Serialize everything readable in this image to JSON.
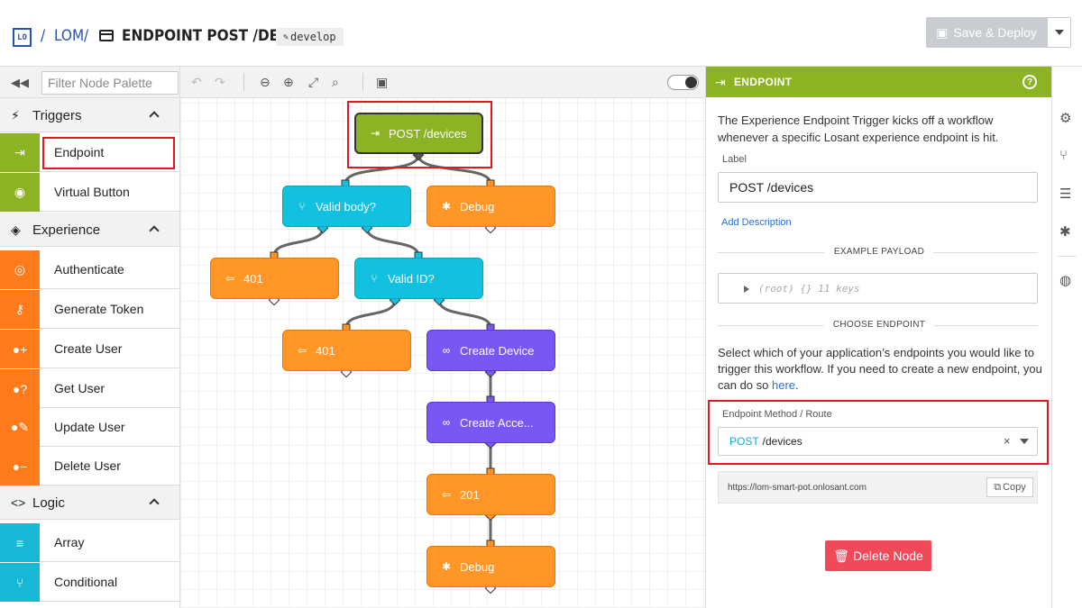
{
  "header": {
    "logo_text": "LO",
    "sep1": "/",
    "app_name": "LOM",
    "sep2": "/",
    "workflow_title": "ENDPOINT POST /DEVICES",
    "branch": "develop",
    "save_label": "Save & Deploy"
  },
  "palette": {
    "filter_placeholder": "Filter Node Palette",
    "categories": [
      {
        "label": "Triggers",
        "items": [
          "Endpoint",
          "Virtual Button"
        ]
      },
      {
        "label": "Experience",
        "items": [
          "Authenticate",
          "Generate Token",
          "Create User",
          "Get User",
          "Update User",
          "Delete User"
        ]
      },
      {
        "label": "Logic",
        "items": [
          "Array",
          "Conditional"
        ]
      }
    ]
  },
  "flow": {
    "nodes": {
      "trigger": "POST /devices",
      "valid_body": "Valid body?",
      "debug1": "Debug",
      "resp401a": "401",
      "valid_id": "Valid ID?",
      "resp401b": "401",
      "create_device": "Create Device",
      "create_access": "Create Acce...",
      "resp201": "201",
      "debug2": "Debug"
    }
  },
  "panel": {
    "title": "ENDPOINT",
    "description": "The Experience Endpoint Trigger kicks off a workflow whenever a specific Losant experience endpoint is hit.",
    "label_caption": "Label",
    "label_value": "POST /devices",
    "add_description": "Add Description",
    "example_payload_heading": "EXAMPLE PAYLOAD",
    "payload_preview": "(root) {} 11 keys",
    "choose_endpoint_heading": "CHOOSE ENDPOINT",
    "choose_text": "Select which of your application’s endpoints you would like to trigger this workflow. If you need to create a new endpoint, you can do so",
    "choose_link": "here",
    "route_caption": "Endpoint Method / Route",
    "route_method": "POST",
    "route_path": "/devices",
    "url": "https://lom-smart-pot.onlosant.com",
    "copy_label": "Copy",
    "delete_label": "Delete Node"
  },
  "colors": {
    "trigger_green": "#8cb324",
    "output_orange": "#ff9626",
    "logic_cyan": "#12c0e0",
    "experience_purple": "#7a56f2",
    "highlight_red": "#e5161e",
    "delete_red": "#f04a5a"
  },
  "icons": [
    "logo-icon",
    "workflow-icon",
    "save-icon",
    "undo-icon",
    "redo-icon",
    "zoom-out-icon",
    "zoom-in-icon",
    "fit-icon",
    "search-icon",
    "comment-icon",
    "settings-icon",
    "branch-icon",
    "database-icon",
    "debug-icon",
    "globe-icon",
    "help-icon"
  ]
}
